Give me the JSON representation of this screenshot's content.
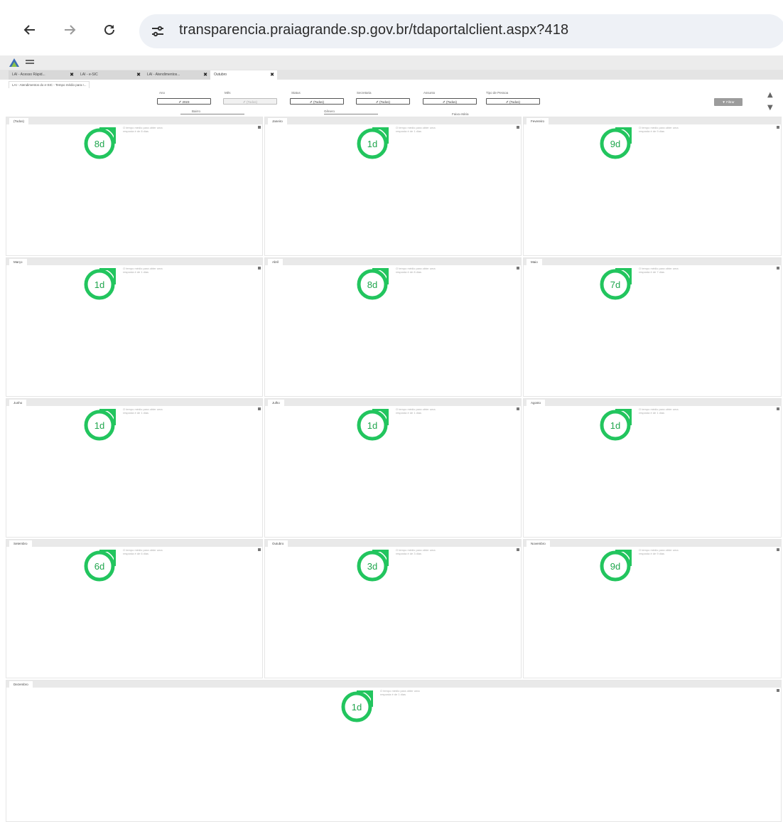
{
  "browser": {
    "back_icon": "arrow-left-icon",
    "forward_icon": "arrow-right-icon",
    "reload_icon": "reload-icon",
    "site_info_icon": "tune-icon",
    "url": "transparencia.praiagrande.sp.gov.br/tdaportalclient.aspx?418"
  },
  "app": {
    "tabs": [
      {
        "label": "LAI - Acesso Rápid..."
      },
      {
        "label": "LAI - e-SIC"
      },
      {
        "label": "LAI - Atendimentos..."
      },
      {
        "label": "Outubro"
      }
    ],
    "subtitle": "LAI - Atendimentos do e-SIC - Tempo médio para r...",
    "filters": {
      "ano": {
        "label": "Ano",
        "value": "✐ 2023"
      },
      "mes": {
        "label": "Mês",
        "value": "✐ (Todos)"
      },
      "status": {
        "label": "Status",
        "value": "✐ (Todos)"
      },
      "secretaria": {
        "label": "Secretaria",
        "value": "✐ (Todos)"
      },
      "assunto": {
        "label": "Assunto",
        "value": "✐ (Todos)"
      },
      "tipo_pessoa": {
        "label": "Tipo de Pessoa",
        "value": "✐ (Todos)"
      },
      "bairro": "Bairro",
      "genero": "Gênero",
      "faixa_etaria": "Faixa etária",
      "filtrar": "▼ Filtrar"
    },
    "accent_color": "#22c55e",
    "panels": [
      {
        "title": "(Todos)",
        "value": "8d",
        "note": "O tempo médio para obter uma resposta é de 8 dias"
      },
      {
        "title": "Janeiro",
        "value": "1d",
        "note": "O tempo médio para obter uma resposta é de 1 dias"
      },
      {
        "title": "Fevereiro",
        "value": "9d",
        "note": "O tempo médio para obter uma resposta é de 9 dias"
      },
      {
        "title": "Março",
        "value": "1d",
        "note": "O tempo médio para obter uma resposta é de 1 dias"
      },
      {
        "title": "Abril",
        "value": "8d",
        "note": "O tempo médio para obter uma resposta é de 8 dias"
      },
      {
        "title": "Maio",
        "value": "7d",
        "note": "O tempo médio para obter uma resposta é de 7 dias"
      },
      {
        "title": "Junho",
        "value": "1d",
        "note": "O tempo médio para obter uma resposta é de 1 dias"
      },
      {
        "title": "Julho",
        "value": "1d",
        "note": "O tempo médio para obter uma resposta é de 1 dias"
      },
      {
        "title": "Agosto",
        "value": "1d",
        "note": "O tempo médio para obter uma resposta é de 1 dias"
      },
      {
        "title": "Setembro",
        "value": "6d",
        "note": "O tempo médio para obter uma resposta é de 6 dias"
      },
      {
        "title": "Outubro",
        "value": "3d",
        "note": "O tempo médio para obter uma resposta é de 3 dias"
      },
      {
        "title": "Novembro",
        "value": "9d",
        "note": "O tempo médio para obter uma resposta é de 9 dias"
      },
      {
        "title": "Dezembro",
        "value": "1d",
        "note": "O tempo médio para obter uma resposta é de 1 dias"
      }
    ]
  }
}
